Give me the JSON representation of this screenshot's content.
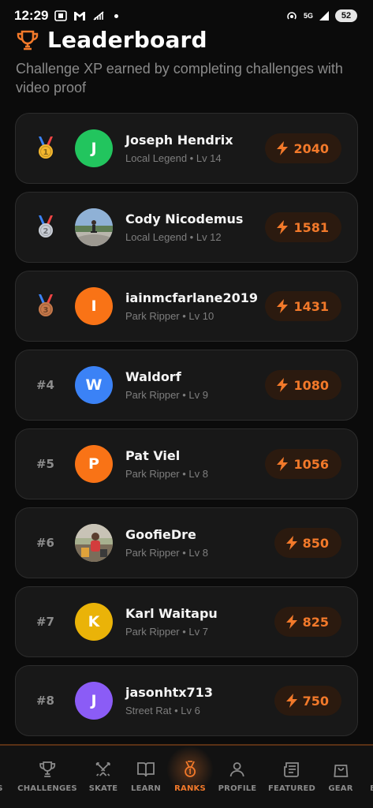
{
  "status_bar": {
    "time": "12:29",
    "network": "5G",
    "battery": "52"
  },
  "header": {
    "title": "Leaderboard",
    "subtitle": "Challenge XP earned by completing challenges with video proof"
  },
  "colors": {
    "accent": "#f2792a",
    "background": "#0b0b0b",
    "card": "#181818"
  },
  "leaders": [
    {
      "rank": "",
      "medal": "gold",
      "initial": "J",
      "avatar_color": "#22c55e",
      "avatar_photo": false,
      "name": "Joseph Hendrix",
      "meta": "Local Legend • Lv 14",
      "xp": "2040"
    },
    {
      "rank": "",
      "medal": "silver",
      "initial": "",
      "avatar_color": "#7a8a99",
      "avatar_photo": true,
      "name": "Cody Nicodemus",
      "meta": "Local Legend • Lv 12",
      "xp": "1581"
    },
    {
      "rank": "",
      "medal": "bronze",
      "initial": "I",
      "avatar_color": "#f97316",
      "avatar_photo": false,
      "name": "iainmcfarlane2019",
      "meta": "Park Ripper • Lv 10",
      "xp": "1431"
    },
    {
      "rank": "#4",
      "medal": "",
      "initial": "W",
      "avatar_color": "#3b82f6",
      "avatar_photo": false,
      "name": "Waldorf",
      "meta": "Park Ripper • Lv 9",
      "xp": "1080"
    },
    {
      "rank": "#5",
      "medal": "",
      "initial": "P",
      "avatar_color": "#f97316",
      "avatar_photo": false,
      "name": "Pat Viel",
      "meta": "Park Ripper • Lv 8",
      "xp": "1056"
    },
    {
      "rank": "#6",
      "medal": "",
      "initial": "",
      "avatar_color": "#8b7a5e",
      "avatar_photo": true,
      "name": "GoofieDre",
      "meta": "Park Ripper • Lv 8",
      "xp": "850"
    },
    {
      "rank": "#7",
      "medal": "",
      "initial": "K",
      "avatar_color": "#eab308",
      "avatar_photo": false,
      "name": "Karl Waitapu",
      "meta": "Park Ripper • Lv 7",
      "xp": "825"
    },
    {
      "rank": "#8",
      "medal": "",
      "initial": "J",
      "avatar_color": "#8b5cf6",
      "avatar_photo": false,
      "name": "jasonhtx713",
      "meta": "Street Rat • Lv 6",
      "xp": "750"
    }
  ],
  "nav": [
    {
      "label": "S",
      "icon": "partial-icon"
    },
    {
      "label": "CHALLENGES",
      "icon": "trophy-icon"
    },
    {
      "label": "SKATE",
      "icon": "swords-icon"
    },
    {
      "label": "LEARN",
      "icon": "book-icon"
    },
    {
      "label": "RANKS",
      "icon": "medal-icon",
      "active": true
    },
    {
      "label": "PROFILE",
      "icon": "user-icon"
    },
    {
      "label": "FEATURED",
      "icon": "newspaper-icon"
    },
    {
      "label": "GEAR",
      "icon": "bag-icon"
    },
    {
      "label": "B",
      "icon": "partial-icon"
    }
  ]
}
